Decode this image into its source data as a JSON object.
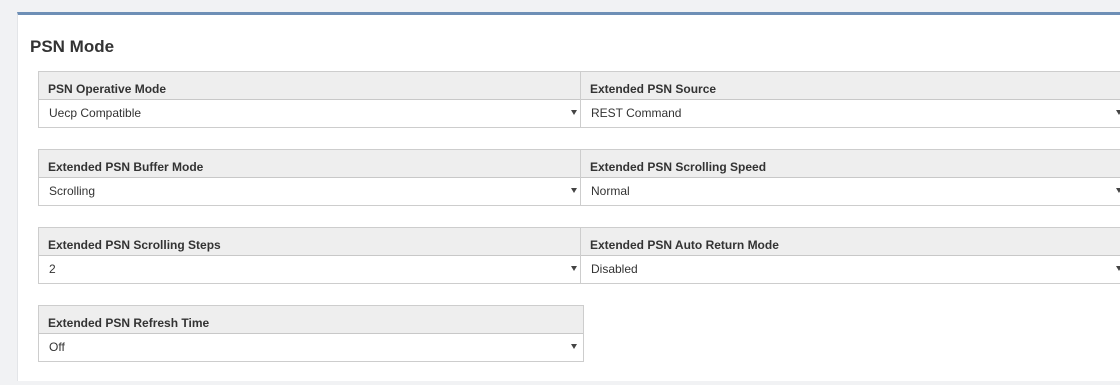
{
  "panel": {
    "title": "PSN Mode",
    "accent_color": "#6e8fb6"
  },
  "fields": [
    {
      "label": "PSN Operative Mode",
      "value": "Uecp Compatible"
    },
    {
      "label": "Extended PSN Source",
      "value": "REST Command"
    },
    {
      "label": "Extended PSN Buffer Mode",
      "value": "Scrolling"
    },
    {
      "label": "Extended PSN Scrolling Speed",
      "value": "Normal"
    },
    {
      "label": "Extended PSN Scrolling Steps",
      "value": "2"
    },
    {
      "label": "Extended PSN Auto Return Mode",
      "value": "Disabled"
    },
    {
      "label": "Extended PSN Refresh Time",
      "value": "Off"
    }
  ]
}
